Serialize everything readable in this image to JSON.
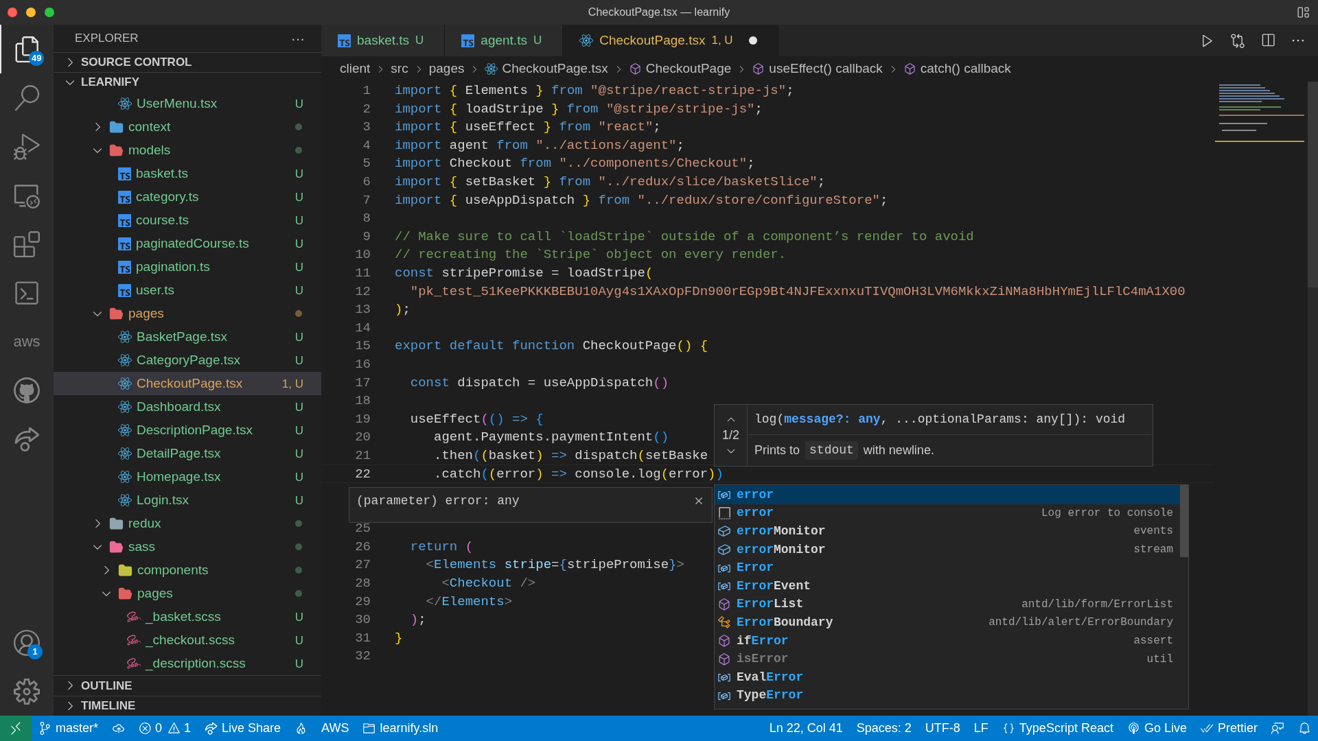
{
  "window": {
    "title": "CheckoutPage.tsx — learnify"
  },
  "activity_bar": {
    "items": [
      {
        "kind": "explorer",
        "selected": true,
        "badge": "49"
      },
      {
        "kind": "search",
        "selected": false
      },
      {
        "kind": "debug",
        "selected": false
      },
      {
        "kind": "remote",
        "selected": false
      },
      {
        "kind": "extensions",
        "selected": false
      },
      {
        "kind": "terminal",
        "selected": false
      },
      {
        "kind": "aws",
        "selected": false,
        "label": "aws"
      },
      {
        "kind": "github",
        "selected": false
      },
      {
        "kind": "liveshare",
        "selected": false
      }
    ],
    "bottom": [
      {
        "kind": "account",
        "badge": "1"
      },
      {
        "kind": "settings"
      }
    ]
  },
  "explorer": {
    "title": "EXPLORER",
    "more": "···",
    "sections_top": [
      {
        "label": "SOURCE CONTROL",
        "expanded": false
      },
      {
        "label": "LEARNIFY",
        "expanded": true
      }
    ],
    "tree": [
      {
        "children": [
          {
            "name": "UserMenu.tsx",
            "kind": "tsx",
            "decoration": "U",
            "has_problem": false,
            "selected": false
          }
        ]
      },
      {
        "name": "context",
        "kind": "folder",
        "expanded": false,
        "color": "#4f9ed6",
        "has_problem": false,
        "selected": false
      },
      {
        "name": "models",
        "kind": "folder",
        "expanded": true,
        "color": "#e06060",
        "has_problem": false,
        "selected": false,
        "children": [
          {
            "name": "basket.ts",
            "kind": "ts",
            "decoration": "U",
            "has_problem": false,
            "selected": false
          },
          {
            "name": "category.ts",
            "kind": "ts",
            "decoration": "U",
            "has_problem": false,
            "selected": false
          },
          {
            "name": "course.ts",
            "kind": "ts",
            "decoration": "U",
            "has_problem": false,
            "selected": false
          },
          {
            "name": "paginatedCourse.ts",
            "kind": "ts",
            "decoration": "U",
            "has_problem": false,
            "selected": false
          },
          {
            "name": "pagination.ts",
            "kind": "ts",
            "decoration": "U",
            "has_problem": false,
            "selected": false
          },
          {
            "name": "user.ts",
            "kind": "ts",
            "decoration": "U",
            "has_problem": false,
            "selected": false
          }
        ]
      },
      {
        "name": "pages",
        "kind": "folder",
        "expanded": true,
        "color": "#e06060",
        "has_problem": true,
        "selected": false,
        "children": [
          {
            "name": "BasketPage.tsx",
            "kind": "tsx",
            "decoration": "U",
            "has_problem": false,
            "selected": false
          },
          {
            "name": "CategoryPage.tsx",
            "kind": "tsx",
            "decoration": "U",
            "has_problem": false,
            "selected": false
          },
          {
            "name": "CheckoutPage.tsx",
            "kind": "tsx",
            "decoration": "1, U",
            "has_problem": true,
            "selected": true
          },
          {
            "name": "Dashboard.tsx",
            "kind": "tsx",
            "decoration": "U",
            "has_problem": false,
            "selected": false
          },
          {
            "name": "DescriptionPage.tsx",
            "kind": "tsx",
            "decoration": "U",
            "has_problem": false,
            "selected": false
          },
          {
            "name": "DetailPage.tsx",
            "kind": "tsx",
            "decoration": "U",
            "has_problem": false,
            "selected": false
          },
          {
            "name": "Homepage.tsx",
            "kind": "tsx",
            "decoration": "U",
            "has_problem": false,
            "selected": false
          },
          {
            "name": "Login.tsx",
            "kind": "tsx",
            "decoration": "U",
            "has_problem": false,
            "selected": false
          }
        ]
      },
      {
        "name": "redux",
        "kind": "folder",
        "expanded": false,
        "color": "#90a4ae",
        "has_problem": false,
        "selected": false
      },
      {
        "name": "sass",
        "kind": "folder",
        "expanded": true,
        "color": "#ec6a96",
        "has_problem": false,
        "selected": false,
        "children": [
          {
            "name": "components",
            "kind": "folder",
            "expanded": false,
            "color": "#c0c040",
            "has_problem": false,
            "selected": false
          },
          {
            "name": "pages",
            "kind": "folder",
            "expanded": true,
            "color": "#e06060",
            "has_problem": false,
            "selected": false,
            "children": [
              {
                "name": "_basket.scss",
                "kind": "scss",
                "decoration": "U",
                "has_problem": false,
                "selected": false
              },
              {
                "name": "_checkout.scss",
                "kind": "scss",
                "decoration": "U",
                "has_problem": false,
                "selected": false
              },
              {
                "name": "_description.scss",
                "kind": "scss",
                "decoration": "U",
                "has_problem": false,
                "selected": false
              }
            ]
          }
        ]
      }
    ],
    "sections_bottom": [
      {
        "label": "OUTLINE",
        "expanded": false
      },
      {
        "label": "TIMELINE",
        "expanded": false
      }
    ]
  },
  "tabs": [
    {
      "label": "basket.ts",
      "kind": "ts",
      "decoration": "U",
      "has_problem": false,
      "selected": false,
      "dirty": false
    },
    {
      "label": "agent.ts",
      "kind": "ts",
      "decoration": "U",
      "has_problem": false,
      "selected": false,
      "dirty": false
    },
    {
      "label": "CheckoutPage.tsx",
      "kind": "tsx",
      "decoration": "1, U",
      "has_problem": true,
      "selected": true,
      "dirty": true
    }
  ],
  "breadcrumbs": [
    {
      "label": "client",
      "kind": "folder"
    },
    {
      "label": "src",
      "kind": "folder"
    },
    {
      "label": "pages",
      "kind": "folder"
    },
    {
      "label": "CheckoutPage.tsx",
      "kind": "file"
    },
    {
      "label": "CheckoutPage",
      "kind": "symbol"
    },
    {
      "label": "useEffect() callback",
      "kind": "symbol"
    },
    {
      "label": "catch() callback",
      "kind": "symbol"
    }
  ],
  "editor": {
    "lines": [
      {
        "number": "1",
        "current": false,
        "tokens": [
          {
            "kind": "keyword",
            "text": "import "
          },
          {
            "kind": "brace",
            "text": "{"
          },
          {
            "kind": "plain",
            "text": " Elements "
          },
          {
            "kind": "brace",
            "text": "}"
          },
          {
            "kind": "keyword",
            "text": " from "
          },
          {
            "kind": "string",
            "text": "\"@stripe/react-stripe-js\""
          },
          {
            "kind": "plain",
            "text": ";"
          }
        ]
      },
      {
        "number": "2",
        "current": false,
        "tokens": [
          {
            "kind": "keyword",
            "text": "import "
          },
          {
            "kind": "brace",
            "text": "{"
          },
          {
            "kind": "plain",
            "text": " loadStripe "
          },
          {
            "kind": "brace",
            "text": "}"
          },
          {
            "kind": "keyword",
            "text": " from "
          },
          {
            "kind": "string",
            "text": "\"@stripe/stripe-js\""
          },
          {
            "kind": "plain",
            "text": ";"
          }
        ]
      },
      {
        "number": "3",
        "current": false,
        "tokens": [
          {
            "kind": "keyword",
            "text": "import "
          },
          {
            "kind": "brace",
            "text": "{"
          },
          {
            "kind": "plain",
            "text": " useEffect "
          },
          {
            "kind": "brace",
            "text": "}"
          },
          {
            "kind": "keyword",
            "text": " from "
          },
          {
            "kind": "string",
            "text": "\"react\""
          },
          {
            "kind": "plain",
            "text": ";"
          }
        ]
      },
      {
        "number": "4",
        "current": false,
        "tokens": [
          {
            "kind": "keyword",
            "text": "import"
          },
          {
            "kind": "plain",
            "text": " agent "
          },
          {
            "kind": "keyword",
            "text": "from "
          },
          {
            "kind": "string",
            "text": "\"../actions/agent\""
          },
          {
            "kind": "plain",
            "text": ";"
          }
        ]
      },
      {
        "number": "5",
        "current": false,
        "tokens": [
          {
            "kind": "keyword",
            "text": "import"
          },
          {
            "kind": "plain",
            "text": " Checkout "
          },
          {
            "kind": "keyword",
            "text": "from "
          },
          {
            "kind": "string",
            "text": "\"../components/Checkout\""
          },
          {
            "kind": "plain",
            "text": ";"
          }
        ]
      },
      {
        "number": "6",
        "current": false,
        "tokens": [
          {
            "kind": "keyword",
            "text": "import "
          },
          {
            "kind": "brace",
            "text": "{"
          },
          {
            "kind": "plain",
            "text": " setBasket "
          },
          {
            "kind": "brace",
            "text": "}"
          },
          {
            "kind": "keyword",
            "text": " from "
          },
          {
            "kind": "string",
            "text": "\"../redux/slice/basketSlice\""
          },
          {
            "kind": "plain",
            "text": ";"
          }
        ]
      },
      {
        "number": "7",
        "current": false,
        "tokens": [
          {
            "kind": "keyword",
            "text": "import "
          },
          {
            "kind": "brace",
            "text": "{"
          },
          {
            "kind": "plain",
            "text": " useAppDispatch "
          },
          {
            "kind": "brace",
            "text": "}"
          },
          {
            "kind": "keyword",
            "text": " from "
          },
          {
            "kind": "string",
            "text": "\"../redux/store/configureStore\""
          },
          {
            "kind": "plain",
            "text": ";"
          }
        ]
      },
      {
        "number": "8",
        "current": false
      },
      {
        "number": "9",
        "current": false,
        "tokens": [
          {
            "kind": "comment",
            "text": "// Make sure to call `loadStripe` outside of a component’s render to avoid"
          }
        ]
      },
      {
        "number": "10",
        "current": false,
        "tokens": [
          {
            "kind": "comment",
            "text": "// recreating the `Stripe` object on every render."
          }
        ]
      },
      {
        "number": "11",
        "current": false,
        "tokens": [
          {
            "kind": "keyword",
            "text": "const"
          },
          {
            "kind": "plain",
            "text": " stripePromise = loadStripe"
          },
          {
            "kind": "brace",
            "text": "("
          }
        ]
      },
      {
        "number": "12",
        "current": false,
        "tokens": [
          {
            "kind": "string",
            "text": "  \"pk_test_51KeePKKKBEBU10Ayg4s1XAxOpFDn900rEGp9Bt4NJFExxnxuTIVQmOH3LVM6MkkxZiNMa8HbHYmEjlLFlC4mA1X00"
          }
        ]
      },
      {
        "number": "13",
        "current": false,
        "tokens": [
          {
            "kind": "brace",
            "text": ")"
          },
          {
            "kind": "plain",
            "text": ";"
          }
        ]
      },
      {
        "number": "14",
        "current": false
      },
      {
        "number": "15",
        "current": false,
        "tokens": [
          {
            "kind": "keyword",
            "text": "export default function"
          },
          {
            "kind": "plain",
            "text": " CheckoutPage"
          },
          {
            "kind": "brace",
            "text": "() {"
          }
        ]
      },
      {
        "number": "16",
        "current": false
      },
      {
        "number": "17",
        "current": false,
        "tokens": [
          {
            "kind": "keyword",
            "text": "  const"
          },
          {
            "kind": "plain",
            "text": " dispatch = useAppDispatch"
          },
          {
            "kind": "paren",
            "text": "()"
          }
        ]
      },
      {
        "number": "18",
        "current": false
      },
      {
        "number": "19",
        "current": false,
        "tokens": [
          {
            "kind": "plain",
            "text": "  useEffect"
          },
          {
            "kind": "paren",
            "text": "("
          },
          {
            "kind": "bracket",
            "text": "()"
          },
          {
            "kind": "keyword",
            "text": " => "
          },
          {
            "kind": "bracket",
            "text": "{"
          }
        ]
      },
      {
        "number": "20",
        "current": false,
        "tokens": [
          {
            "kind": "plain",
            "text": "     agent.Payments.paymentIntent"
          },
          {
            "kind": "bracket",
            "text": "()"
          }
        ]
      },
      {
        "number": "21",
        "current": false,
        "tokens": [
          {
            "kind": "plain",
            "text": "     .then"
          },
          {
            "kind": "bracket",
            "text": "("
          },
          {
            "kind": "brace",
            "text": "("
          },
          {
            "kind": "plain",
            "text": "basket"
          },
          {
            "kind": "brace",
            "text": ")"
          },
          {
            "kind": "keyword",
            "text": " => "
          },
          {
            "kind": "plain",
            "text": "dispatch"
          },
          {
            "kind": "brace",
            "text": "("
          },
          {
            "kind": "plain",
            "text": "setBaske"
          }
        ]
      },
      {
        "number": "22",
        "current": true,
        "tokens": [
          {
            "kind": "plain",
            "text": "     .catch"
          },
          {
            "kind": "bracket",
            "text": "("
          },
          {
            "kind": "brace",
            "text": "("
          },
          {
            "kind": "plain",
            "text": "error"
          },
          {
            "kind": "brace",
            "text": ")"
          },
          {
            "kind": "keyword",
            "text": " => "
          },
          {
            "kind": "plain",
            "text": "console.log"
          },
          {
            "kind": "brace",
            "text": "("
          },
          {
            "kind": "plain",
            "text": "error"
          },
          {
            "kind": "brace",
            "text": ")"
          },
          {
            "kind": "bracket",
            "text": ")"
          }
        ]
      },
      {
        "number": "25",
        "current": false
      },
      {
        "number": "26",
        "current": false,
        "tokens": [
          {
            "kind": "keyword",
            "text": "  return "
          },
          {
            "kind": "paren",
            "text": "("
          }
        ]
      },
      {
        "number": "27",
        "current": false,
        "tokens": [
          {
            "kind": "angle",
            "text": "    <"
          },
          {
            "kind": "tag",
            "text": "Elements"
          },
          {
            "kind": "attr",
            "text": " stripe"
          },
          {
            "kind": "plain",
            "text": "="
          },
          {
            "kind": "keyword",
            "text": "{"
          },
          {
            "kind": "plain",
            "text": "stripePromise"
          },
          {
            "kind": "keyword",
            "text": "}"
          },
          {
            "kind": "angle",
            "text": ">"
          }
        ]
      },
      {
        "number": "28",
        "current": false,
        "tokens": [
          {
            "kind": "angle",
            "text": "      <"
          },
          {
            "kind": "tag",
            "text": "Checkout"
          },
          {
            "kind": "angle",
            "text": " />"
          }
        ]
      },
      {
        "number": "29",
        "current": false,
        "tokens": [
          {
            "kind": "angle",
            "text": "    </"
          },
          {
            "kind": "tag",
            "text": "Elements"
          },
          {
            "kind": "angle",
            "text": ">"
          }
        ]
      },
      {
        "number": "30",
        "current": false,
        "tokens": [
          {
            "kind": "paren",
            "text": "  )"
          },
          {
            "kind": "plain",
            "text": ";"
          }
        ]
      },
      {
        "number": "31",
        "current": false,
        "tokens": [
          {
            "kind": "brace",
            "text": "}"
          }
        ]
      },
      {
        "number": "32",
        "current": false
      }
    ]
  },
  "signature_help": {
    "counter": "1/2",
    "signature": [
      {
        "kind": "plain",
        "text": "log("
      },
      {
        "kind": "param",
        "text": "message?: any"
      },
      {
        "kind": "plain",
        "text": ", ...optionalParams: any[]): void"
      }
    ],
    "doc": {
      "before": "Prints to",
      "code": "stdout",
      "after": "with newline."
    }
  },
  "hover": {
    "text": "(parameter) error: any"
  },
  "suggestions": [
    {
      "kind": "variable",
      "match": "error",
      "selected": true,
      "deprecated": false
    },
    {
      "kind": "snippet",
      "match": "error",
      "detail": "Log error to console",
      "selected": false,
      "deprecated": false
    },
    {
      "kind": "field",
      "match": "error",
      "rest": "Monitor",
      "detail": "events",
      "selected": false,
      "deprecated": false
    },
    {
      "kind": "field",
      "match": "error",
      "rest": "Monitor",
      "detail": "stream",
      "selected": false,
      "deprecated": false
    },
    {
      "kind": "variable",
      "match": "Error",
      "selected": false,
      "deprecated": false
    },
    {
      "kind": "variable",
      "match": "Error",
      "rest": "Event",
      "selected": false,
      "deprecated": false
    },
    {
      "kind": "method",
      "match": "Error",
      "rest": "List",
      "detail": "antd/lib/form/ErrorList",
      "selected": false,
      "deprecated": false
    },
    {
      "kind": "class",
      "match": "Error",
      "rest": "Boundary",
      "detail": "antd/lib/alert/ErrorBoundary",
      "selected": false,
      "deprecated": false
    },
    {
      "kind": "method",
      "pre": "if",
      "match": "Error",
      "detail": "assert",
      "selected": false,
      "deprecated": false
    },
    {
      "kind": "method",
      "pre": "is",
      "match": "Error",
      "detail": "util",
      "selected": false,
      "deprecated": true
    },
    {
      "kind": "variable",
      "pre": "Eval",
      "match": "Error",
      "selected": false,
      "deprecated": false
    },
    {
      "kind": "variable",
      "pre": "Type",
      "match": "Error",
      "selected": false,
      "deprecated": false
    }
  ],
  "status_bar": {
    "left": [
      {
        "kind": "remote"
      },
      {
        "kind": "branch",
        "text": "master*"
      },
      {
        "kind": "sync"
      },
      {
        "kind": "problems",
        "errors": "0",
        "warnings": "1"
      },
      {
        "kind": "liveshare",
        "text": "Live Share"
      },
      {
        "kind": "flame"
      },
      {
        "kind": "text",
        "text": "AWS"
      },
      {
        "kind": "folder",
        "text": "learnify.sln"
      }
    ],
    "right": [
      {
        "kind": "text",
        "text": "Ln 22, Col 41"
      },
      {
        "kind": "text",
        "text": "Spaces: 2"
      },
      {
        "kind": "text",
        "text": "UTF-8"
      },
      {
        "kind": "text",
        "text": "LF"
      },
      {
        "kind": "language",
        "text": "TypeScript React"
      },
      {
        "kind": "golive",
        "text": "Go Live"
      },
      {
        "kind": "prettier",
        "text": "Prettier"
      },
      {
        "kind": "feedback"
      },
      {
        "kind": "bell"
      }
    ]
  }
}
